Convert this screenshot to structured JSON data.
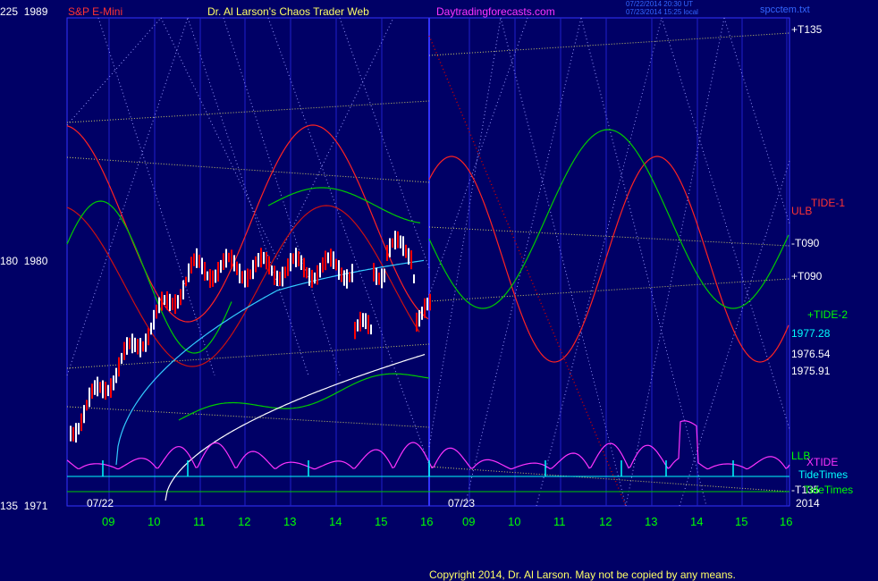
{
  "header": {
    "symbol": "S&P E-Mini",
    "title": "Dr. Al Larson's Chaos Trader Web",
    "site": "Daytradingforecasts.com",
    "stamp1": "07/22/2014 20:30 UT",
    "stamp2": "07/23/2014 15:25 local",
    "file": "spcctem.txt"
  },
  "footer": {
    "copyright": "Copyright 2014, Dr. Al Larson. May not be copied by any means."
  },
  "chart_data": {
    "type": "line",
    "title": "S&P E-Mini",
    "y_left": {
      "ticks": [
        {
          "angle": "225",
          "price": "1989"
        },
        {
          "angle": "180",
          "price": "1980"
        },
        {
          "angle": "135",
          "price": "1971"
        }
      ]
    },
    "ylim": [
      1971,
      1989
    ],
    "date_labels": [
      "07/22",
      "07/23"
    ],
    "year_label": "2014",
    "x_hours": [
      "09",
      "10",
      "11",
      "12",
      "13",
      "14",
      "15",
      "16",
      "09",
      "10",
      "11",
      "12",
      "13",
      "14",
      "15",
      "16"
    ],
    "right_labels": {
      "t135p": "+T135",
      "tide1": "TIDE-1",
      "ulb": "ULB",
      "t090m": "-T090",
      "t090p": "+T090",
      "tide2": "+TIDE-2",
      "p1": "1977.28",
      "p2": "1976.54",
      "p3": "1975.91",
      "llb": "LLB",
      "xtide": "XTIDE",
      "tidetimes1": "TideTimes",
      "t135m": "-T135",
      "tidetimes2": "TideTimes"
    },
    "price_levels": [
      1977.28,
      1976.54,
      1975.91
    ],
    "series": [
      {
        "name": "TIDE-1",
        "color": "#ff0000"
      },
      {
        "name": "+TIDE-2",
        "color": "#00ff00"
      },
      {
        "name": "XTIDE",
        "color": "#ff33ff"
      },
      {
        "name": "TideTimes",
        "color": "#00ffff"
      }
    ]
  }
}
